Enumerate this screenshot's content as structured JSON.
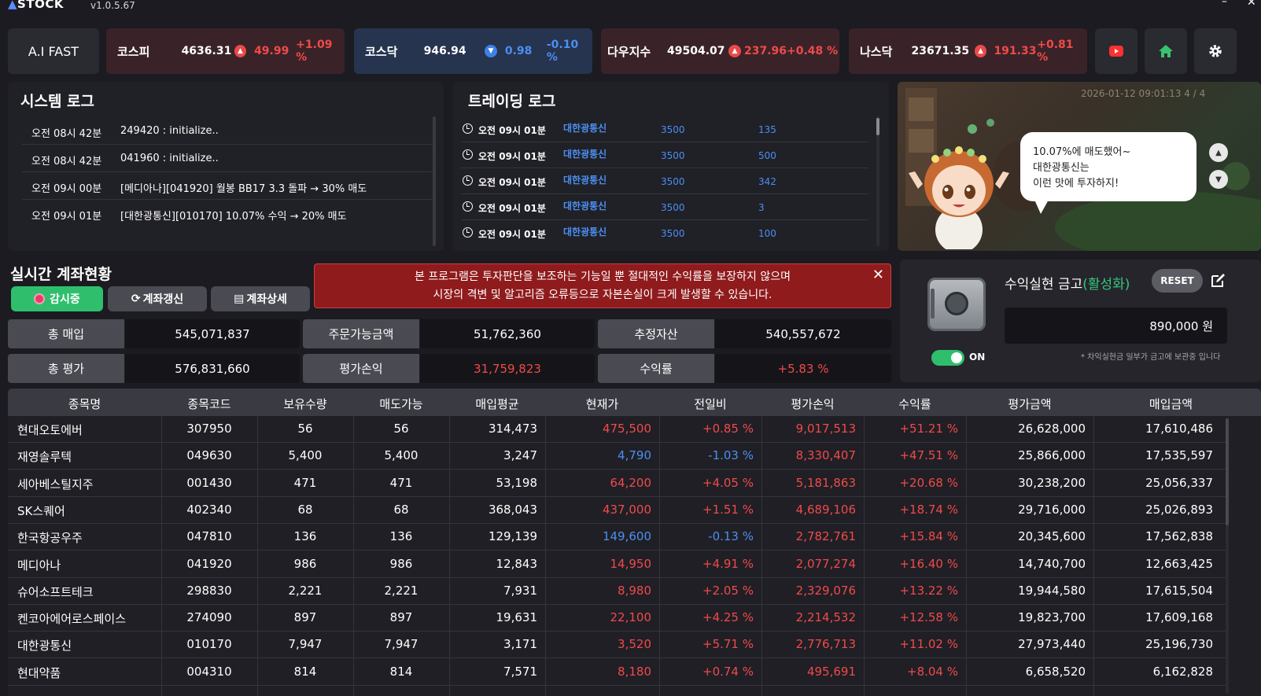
{
  "app": {
    "logo": "STOCK",
    "version": "v1.0.5.67",
    "win_min": "–",
    "win_close": "✕"
  },
  "ticker": {
    "aifast": "A.I FAST",
    "items": [
      {
        "name": "코스피",
        "value": "4636.31",
        "change": "49.99",
        "pct": "+1.09 %",
        "dir": "up"
      },
      {
        "name": "코스닥",
        "value": "946.94",
        "change": "0.98",
        "pct": "-0.10 %",
        "dir": "down"
      },
      {
        "name": "다우지수",
        "value": "49504.07",
        "change": "237.96",
        "pct": "+0.48 %",
        "dir": "up"
      },
      {
        "name": "나스닥",
        "value": "23671.35",
        "change": "191.33",
        "pct": "+0.81 %",
        "dir": "up"
      }
    ]
  },
  "system_log": {
    "title": "시스템 로그",
    "rows": [
      {
        "time": "오전 08시 42분",
        "msg": "249420 : initialize.."
      },
      {
        "time": "오전 08시 42분",
        "msg": "041960 : initialize.."
      },
      {
        "time": "오전 09시 00분",
        "msg": "[메디아나][041920] 월봉 BB17 3.3 돌파 → 30% 매도"
      },
      {
        "time": "오전 09시 01분",
        "msg": "[대한광통신][010170] 10.07% 수익 → 20% 매도"
      }
    ]
  },
  "trading_log": {
    "title": "트레이딩 로그",
    "rows": [
      {
        "time": "오전 09시 01분",
        "name": "대한광통신",
        "price": "3500",
        "qty": "135"
      },
      {
        "time": "오전 09시 01분",
        "name": "대한광통신",
        "price": "3500",
        "qty": "500"
      },
      {
        "time": "오전 09시 01분",
        "name": "대한광통신",
        "price": "3500",
        "qty": "342"
      },
      {
        "time": "오전 09시 01분",
        "name": "대한광통신",
        "price": "3500",
        "qty": "3"
      },
      {
        "time": "오전 09시 01분",
        "name": "대한광통신",
        "price": "3500",
        "qty": "100"
      }
    ]
  },
  "character": {
    "timestamp": "2026-01-12 09:01:13  4 / 4",
    "bubble": [
      "10.07%에 매도했어~",
      "대한광통신는",
      "이런 맛에 투자하지!"
    ]
  },
  "account": {
    "title": "실시간 계좌현황",
    "buttons": {
      "monitor": "감시중",
      "refresh": "계좌갱신",
      "detail": "계좌상세"
    },
    "warning": [
      "본 프로그램은 투자판단을 보조하는 기능일 뿐 절대적인 수익률을 보장하지 않으며",
      "시장의 격변 및 알고리즘 오류등으로 자본손실이 크게 발생할 수 있습니다."
    ],
    "stats": {
      "total_buy_label": "총 매입",
      "total_buy": "545,071,837",
      "order_avail_label": "주문가능금액",
      "order_avail": "51,762,360",
      "est_asset_label": "추정자산",
      "est_asset": "540,557,672",
      "total_eval_label": "총 평가",
      "total_eval": "576,831,660",
      "eval_pl_label": "평가손익",
      "eval_pl": "31,759,823",
      "return_label": "수익률",
      "return": "+5.83 %"
    }
  },
  "safe": {
    "title": "수익실현 금고",
    "status": "(활성화)",
    "reset": "RESET",
    "amount": "890,000 원",
    "toggle": "ON",
    "note": "* 차익실현금 일부가 금고에 보관중 입니다"
  },
  "table": {
    "headers": [
      "종목명",
      "종목코드",
      "보유수량",
      "매도가능",
      "매입평균",
      "현재가",
      "전일비",
      "평가손익",
      "수익률",
      "평가금액",
      "매입금액"
    ],
    "rows": [
      {
        "name": "현대오토에버",
        "code": "307950",
        "hold": "56",
        "sell": "56",
        "avg": "314,473",
        "cur": "475,500",
        "chg": "+0.85 %",
        "pl": "9,017,513",
        "ret": "+51.21 %",
        "eval": "26,628,000",
        "buy": "17,610,486",
        "dir": "up"
      },
      {
        "name": "재영솔루텍",
        "code": "049630",
        "hold": "5,400",
        "sell": "5,400",
        "avg": "3,247",
        "cur": "4,790",
        "chg": "-1.03 %",
        "pl": "8,330,407",
        "ret": "+47.51 %",
        "eval": "25,866,000",
        "buy": "17,535,597",
        "dir": "down"
      },
      {
        "name": "세아베스틸지주",
        "code": "001430",
        "hold": "471",
        "sell": "471",
        "avg": "53,198",
        "cur": "64,200",
        "chg": "+4.05 %",
        "pl": "5,181,863",
        "ret": "+20.68 %",
        "eval": "30,238,200",
        "buy": "25,056,337",
        "dir": "up"
      },
      {
        "name": "SK스퀘어",
        "code": "402340",
        "hold": "68",
        "sell": "68",
        "avg": "368,043",
        "cur": "437,000",
        "chg": "+1.51 %",
        "pl": "4,689,106",
        "ret": "+18.74 %",
        "eval": "29,716,000",
        "buy": "25,026,893",
        "dir": "up"
      },
      {
        "name": "한국항공우주",
        "code": "047810",
        "hold": "136",
        "sell": "136",
        "avg": "129,139",
        "cur": "149,600",
        "chg": "-0.13 %",
        "pl": "2,782,761",
        "ret": "+15.84 %",
        "eval": "20,345,600",
        "buy": "17,562,838",
        "dir": "down"
      },
      {
        "name": "메디아나",
        "code": "041920",
        "hold": "986",
        "sell": "986",
        "avg": "12,843",
        "cur": "14,950",
        "chg": "+4.91 %",
        "pl": "2,077,274",
        "ret": "+16.40 %",
        "eval": "14,740,700",
        "buy": "12,663,425",
        "dir": "up"
      },
      {
        "name": "슈어소프트테크",
        "code": "298830",
        "hold": "2,221",
        "sell": "2,221",
        "avg": "7,931",
        "cur": "8,980",
        "chg": "+2.05 %",
        "pl": "2,329,076",
        "ret": "+13.22 %",
        "eval": "19,944,580",
        "buy": "17,615,504",
        "dir": "up"
      },
      {
        "name": "켄코아에어로스페이스",
        "code": "274090",
        "hold": "897",
        "sell": "897",
        "avg": "19,631",
        "cur": "22,100",
        "chg": "+4.25 %",
        "pl": "2,214,532",
        "ret": "+12.58 %",
        "eval": "19,823,700",
        "buy": "17,609,168",
        "dir": "up"
      },
      {
        "name": "대한광통신",
        "code": "010170",
        "hold": "7,947",
        "sell": "7,947",
        "avg": "3,171",
        "cur": "3,520",
        "chg": "+5.71 %",
        "pl": "2,776,713",
        "ret": "+11.02 %",
        "eval": "27,973,440",
        "buy": "25,196,730",
        "dir": "up"
      },
      {
        "name": "현대약품",
        "code": "004310",
        "hold": "814",
        "sell": "814",
        "avg": "7,571",
        "cur": "8,180",
        "chg": "+0.74 %",
        "pl": "495,691",
        "ret": "+8.04 %",
        "eval": "6,658,520",
        "buy": "6,162,828",
        "dir": "up"
      }
    ]
  },
  "colors": {
    "up": "#f04a4a",
    "down": "#4c8ff0",
    "accent_green": "#2fbf6c",
    "warning_bg": "#8f1b1d"
  }
}
